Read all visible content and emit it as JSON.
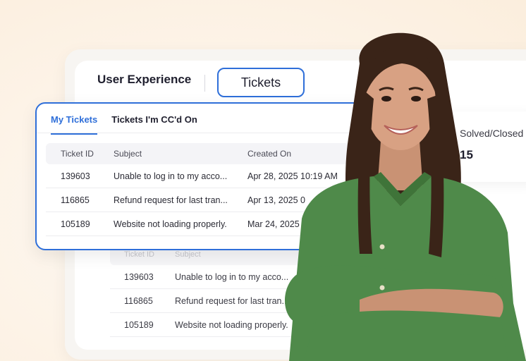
{
  "header": {
    "tabs": [
      {
        "label": "User Experience",
        "active": false
      },
      {
        "label": "Tickets",
        "active": true
      }
    ]
  },
  "ticket_panel": {
    "subtabs": [
      {
        "label": "My Tickets",
        "active": true
      },
      {
        "label": "Tickets I'm CC'd On",
        "active": false
      }
    ],
    "columns": [
      "Ticket ID",
      "Subject",
      "Created On"
    ],
    "rows": [
      {
        "id": "139603",
        "subject": "Unable to log in to my acco...",
        "created": "Apr 28, 2025 10:19 AM"
      },
      {
        "id": "116865",
        "subject": "Refund request for last tran...",
        "created": "Apr 13, 2025 0"
      },
      {
        "id": "105189",
        "subject": "Website not loading properly.",
        "created": "Mar 24, 2025"
      }
    ]
  },
  "background_table": {
    "columns": [
      "Ticket ID",
      "Subject"
    ],
    "rows": [
      {
        "id": "139603",
        "subject": "Unable to log in to my acco..."
      },
      {
        "id": "116865",
        "subject": "Refund request for last tran..."
      },
      {
        "id": "105189",
        "subject": "Website not loading properly."
      }
    ]
  },
  "stats": {
    "label": "Solved/Closed",
    "value": "15"
  },
  "colors": {
    "accent": "#2f6fd9",
    "background": "#fdf1e4",
    "shirt": "#4f8a4a"
  }
}
